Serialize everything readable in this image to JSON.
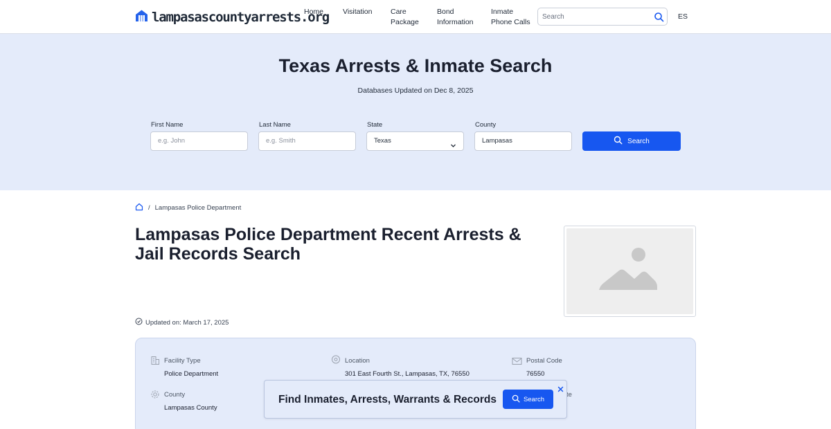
{
  "header": {
    "logo_text": "lampasascountyarrests.org",
    "nav": [
      {
        "line1": "Home",
        "line2": ""
      },
      {
        "line1": "Visitation",
        "line2": ""
      },
      {
        "line1": "Care",
        "line2": "Package"
      },
      {
        "line1": "Bond",
        "line2": "Information"
      },
      {
        "line1": "Inmate",
        "line2": "Phone Calls"
      }
    ],
    "search_placeholder": "Search",
    "lang": "ES"
  },
  "hero": {
    "title": "Texas Arrests & Inmate Search",
    "subtitle": "Databases Updated on Dec 8, 2025",
    "fields": {
      "first_name": {
        "label": "First Name",
        "placeholder": "e.g. John"
      },
      "last_name": {
        "label": "Last Name",
        "placeholder": "e.g. Smith"
      },
      "state": {
        "label": "State",
        "value": "Texas"
      },
      "county": {
        "label": "County",
        "value": "Lampasas"
      }
    },
    "search_button": "Search"
  },
  "breadcrumb": {
    "separator": "/",
    "current": "Lampasas Police Department"
  },
  "page": {
    "title": "Lampasas Police Department Recent Arrests & Jail Records Search",
    "updated": "Updated on: March 17, 2025"
  },
  "info": {
    "facility_type": {
      "label": "Facility Type",
      "value": "Police Department"
    },
    "location": {
      "label": "Location",
      "value": "301 East Fourth St., Lampasas, TX, 76550"
    },
    "postal_code": {
      "label": "Postal Code",
      "value": "76550"
    },
    "county": {
      "label": "County",
      "value": "Lampasas County"
    },
    "partial_label": "te"
  },
  "banner": {
    "text": "Find Inmates, Arrests, Warrants & Records",
    "button": "Search"
  },
  "colors": {
    "primary": "#1757f0",
    "hero_bg": "#e4ebfa",
    "text": "#1a1f2e",
    "logo_blue": "#2563eb"
  }
}
